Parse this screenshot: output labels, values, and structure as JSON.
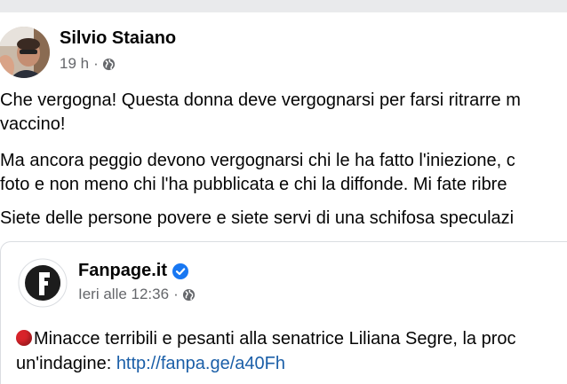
{
  "post": {
    "author": "Silvio Staiano",
    "time": "19 h",
    "separator": "·",
    "paragraphs": [
      {
        "line1": "Che vergogna! Questa donna deve vergognarsi per farsi ritrarre m",
        "line2": "vaccino!"
      },
      {
        "line1": "Ma ancora peggio devono vergognarsi chi le ha fatto l'iniezione, c",
        "line2": "foto e non meno chi l'ha pubblicata  e chi la diffonde. Mi fate ribre"
      },
      {
        "line1": "Siete delle persone povere  e siete servi di una schifosa speculazi"
      }
    ]
  },
  "shared": {
    "page_name": "Fanpage.it",
    "time": "Ieri alle 12:36",
    "separator": "·",
    "text_line1": "Minacce terribili e pesanti alla senatrice Liliana Segre, la proc",
    "text_line2_prefix": "un'indagine: ",
    "link": "http://fanpa.ge/a40Fh"
  },
  "icons": {
    "privacy": "globe-icon",
    "verified": "verified-badge-icon",
    "emoji": "red-circle-emoji"
  },
  "colors": {
    "text": "#050505",
    "meta": "#65676b",
    "link": "#1b5fa8",
    "verified": "#1877f2",
    "emoji_red": "#d8232a"
  }
}
